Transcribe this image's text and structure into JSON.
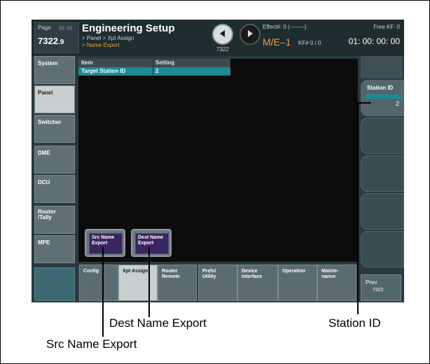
{
  "header": {
    "page_label": "Page",
    "page_number": "7322",
    "page_suffix": ".9",
    "title": "Engineering Setup",
    "breadcrumb": "> Panel > Xpt Assign",
    "breadcrumb_current": "> Name Export",
    "kf_page": "7322",
    "effect": "Effect#: 0 (--------)",
    "me": "M/E–1",
    "kf": "KF# 0 / 0",
    "free_kf": "Free KF: 0",
    "timecode": "01: 00: 00: 00"
  },
  "left_menu": [
    "System",
    "Panel",
    "Switcher",
    "DME",
    "DCU",
    "Router\n/Tally",
    "MPE"
  ],
  "table": {
    "headers": [
      "Item",
      "Setting"
    ],
    "rows": [
      [
        "Target Station ID",
        "2"
      ]
    ]
  },
  "buttons": {
    "src_name_export": "Src Name\nExport",
    "dest_name_export": "Dest Name\nExport"
  },
  "right_panel": {
    "station_id_label": "Station ID",
    "station_id_value": "2"
  },
  "bottom_tabs": [
    "Config",
    "Xpt Assign",
    "Router\nRemote",
    "Prefs/\nUtility",
    "Device\nInterface",
    "Operation",
    "Mainte-\nnance"
  ],
  "prev": {
    "label": "Prev",
    "page": "7322"
  },
  "callouts": {
    "dest": "Dest Name Export",
    "station": "Station ID",
    "src": "Src Name Export"
  },
  "colors": {
    "accent_orange": "#f0a040",
    "teal": "#1c8a95",
    "purple": "#3a2560"
  }
}
